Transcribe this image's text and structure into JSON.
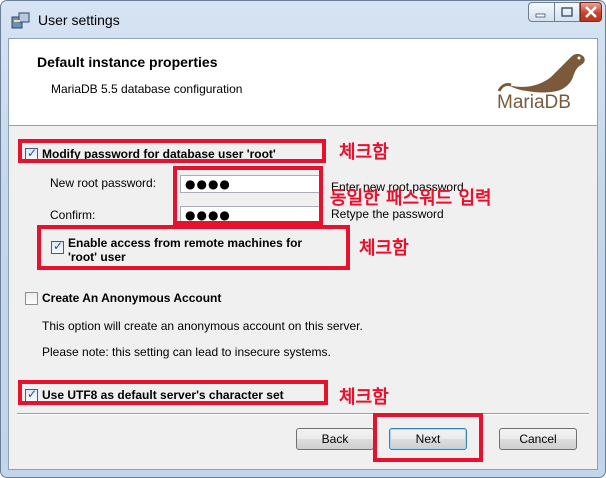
{
  "window": {
    "title": "User settings"
  },
  "header": {
    "title": "Default instance properties",
    "subtitle": "MariaDB 5.5 database configuration",
    "logo_text": "MariaDB"
  },
  "form": {
    "modify_password": {
      "label": "Modify password for database user 'root'",
      "checked": true
    },
    "new_password": {
      "label": "New root password:",
      "value": "●●●●",
      "hint": "Enter new root password"
    },
    "confirm": {
      "label": "Confirm:",
      "value": "●●●●",
      "hint": "Retype the password"
    },
    "remote_access": {
      "label_line1": "Enable access from remote machines for",
      "label_line2": "'root' user",
      "checked": true
    },
    "anonymous": {
      "label": "Create An Anonymous Account",
      "checked": false,
      "desc1": "This option will create an anonymous account on this server.",
      "desc2": "Please note: this setting can lead to insecure systems."
    },
    "utf8": {
      "label": "Use UTF8 as default server's character set",
      "checked": true
    }
  },
  "buttons": {
    "back": "Back",
    "next": "Next",
    "cancel": "Cancel"
  },
  "annotations": {
    "check1": "체크함",
    "same_password": "동일한 패스워드 입력",
    "check2": "체크함",
    "check3": "체크함"
  },
  "colors": {
    "highlight": "#e8112d",
    "logo": "#7a5a3b"
  }
}
